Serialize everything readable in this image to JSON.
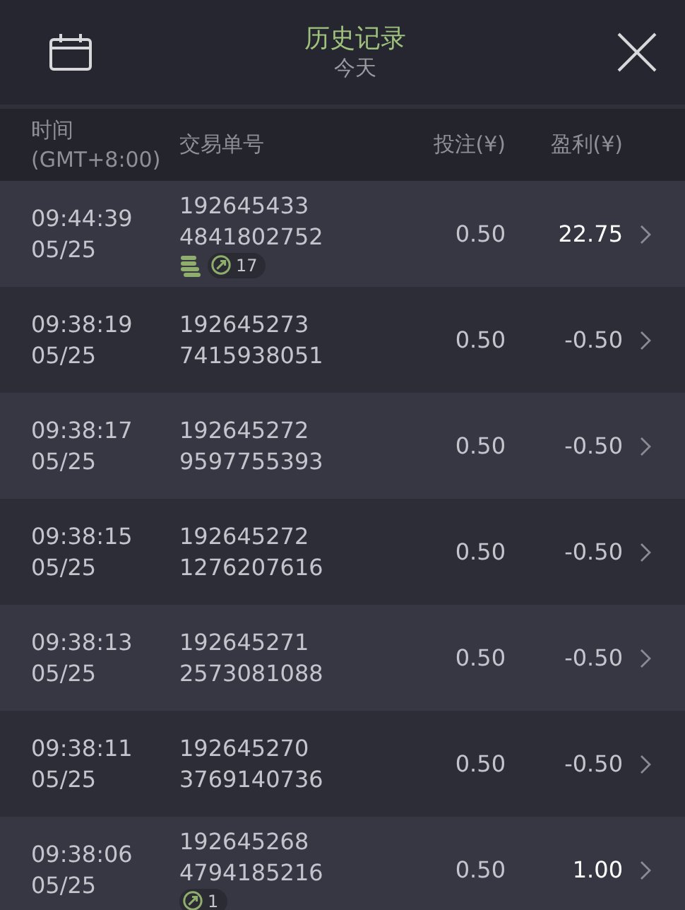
{
  "header": {
    "title": "历史记录",
    "subtitle": "今天"
  },
  "columns": {
    "time": [
      "时间",
      "(GMT+8:00)"
    ],
    "order": "交易单号",
    "stake": "投注(¥)",
    "profit": "盈利(¥)"
  },
  "rows": [
    {
      "time": "09:44:39",
      "date": "05/25",
      "order": [
        "192645433",
        "4841802752"
      ],
      "stake": "0.50",
      "profit": "22.75",
      "win": true,
      "coins": true,
      "badge": "17"
    },
    {
      "time": "09:38:19",
      "date": "05/25",
      "order": [
        "192645273",
        "7415938051"
      ],
      "stake": "0.50",
      "profit": "-0.50",
      "win": false,
      "coins": false
    },
    {
      "time": "09:38:17",
      "date": "05/25",
      "order": [
        "192645272",
        "9597755393"
      ],
      "stake": "0.50",
      "profit": "-0.50",
      "win": false,
      "coins": false
    },
    {
      "time": "09:38:15",
      "date": "05/25",
      "order": [
        "192645272",
        "1276207616"
      ],
      "stake": "0.50",
      "profit": "-0.50",
      "win": false,
      "coins": false
    },
    {
      "time": "09:38:13",
      "date": "05/25",
      "order": [
        "192645271",
        "2573081088"
      ],
      "stake": "0.50",
      "profit": "-0.50",
      "win": false,
      "coins": false
    },
    {
      "time": "09:38:11",
      "date": "05/25",
      "order": [
        "192645270",
        "3769140736"
      ],
      "stake": "0.50",
      "profit": "-0.50",
      "win": false,
      "coins": false
    },
    {
      "time": "09:38:06",
      "date": "05/25",
      "order": [
        "192645268",
        "4794185216"
      ],
      "stake": "0.50",
      "profit": "1.00",
      "win": true,
      "coins": false,
      "badge": "1"
    }
  ]
}
